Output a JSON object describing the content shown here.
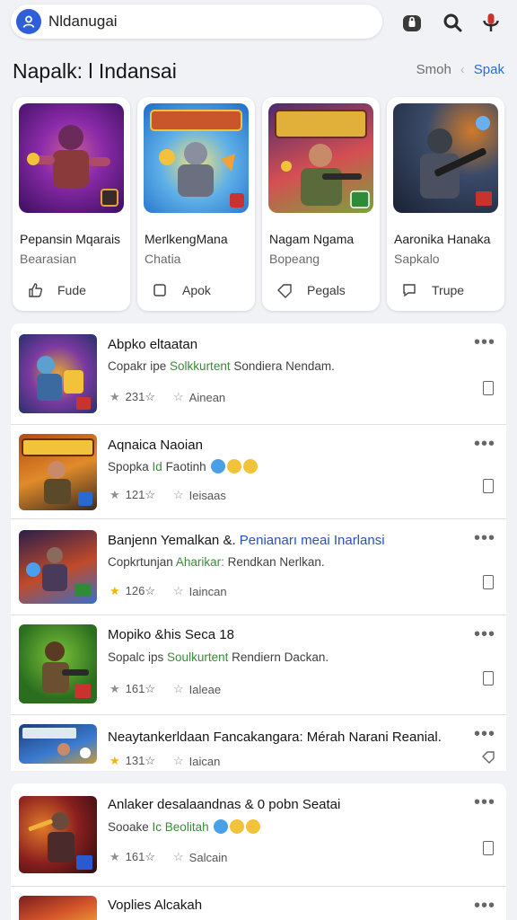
{
  "search": {
    "value": "Nldanugai"
  },
  "section": {
    "title": "Napalk: l Indansai",
    "link1": "Smoh",
    "link2": "Spak"
  },
  "cards": [
    {
      "title": "Pepansin Mqarais",
      "sub": "Bearasian",
      "action": "Fude",
      "icon": "thumb-up-icon",
      "palette": [
        "#3a0f5e",
        "#8a2aa8",
        "#c95b9a"
      ]
    },
    {
      "title": "MerlkengMana",
      "sub": "Chatia",
      "action": "Apok",
      "icon": "square-icon",
      "palette": [
        "#1f6cc9",
        "#5fb0e8",
        "#f2c23a"
      ]
    },
    {
      "title": "Nagam Ngama",
      "sub": "Bopeang",
      "action": "Pegals",
      "icon": "tag-icon",
      "palette": [
        "#4b2a6e",
        "#d54f52",
        "#7aa33c"
      ]
    },
    {
      "title": "Aaronika Hanaka",
      "sub": "Sapkalo",
      "action": "Trupe",
      "icon": "comment-icon",
      "palette": [
        "#1a2233",
        "#3a4a68",
        "#d07a2a"
      ]
    }
  ],
  "list": [
    {
      "title": "Abpko eltaatan",
      "sub_a": "Copakr ipe ",
      "sub_green": "Solkkurtent",
      "sub_b": " Sondiera Nendam.",
      "rating": "231☆",
      "meta": "Ainean",
      "star": "grey",
      "palette": [
        "#28306e",
        "#7b3aa0",
        "#e2a436"
      ]
    },
    {
      "title": "Aqnaica Naoian",
      "sub_a": "Spopka ",
      "sub_green": "Id",
      "sub_b": " Faotinh",
      "emoji": true,
      "rating": "121☆",
      "meta": "Ieisaas",
      "star": "grey",
      "palette": [
        "#b34b12",
        "#e08b2a",
        "#3c2a1e"
      ]
    },
    {
      "title": "Banjenn Yemalkan &. ",
      "title_blue": "Penianarı meai Inarlansi",
      "sub_a": "Copkrtunjan ",
      "sub_green": "Aharikar:",
      "sub_b": " Rendkan Nerlkan.",
      "rating": "126☆",
      "meta": "Iaincan",
      "star": "yellow",
      "palette": [
        "#2b1f4a",
        "#c04a2a",
        "#3a6ec8"
      ]
    },
    {
      "title": "Mopiko &his Seca 18",
      "sub_a": "Sopalc ips ",
      "sub_green": "Soulkurtent",
      "sub_b": " Rendiern Dackan.",
      "rating": "161☆",
      "meta": "Ialeae",
      "star": "grey",
      "palette": [
        "#2b6e1e",
        "#7ac23a",
        "#5a3a22"
      ]
    },
    {
      "title": "Neaytankerldaan Fancakangara: Mérah Narani Reanial.",
      "sub_a": "",
      "sub_green": "",
      "sub_b": "",
      "rating": "131☆",
      "meta": "Iaican",
      "star": "yellow",
      "palette": [
        "#1c3d7a",
        "#3b7bd0",
        "#c79a3a"
      ]
    },
    {
      "title": "Anlaker desalaandnas & 0 pobn Seatai",
      "sub_a": "Sooake ",
      "sub_green": "Ic Beolitah",
      "sub_b": "",
      "emoji": true,
      "rating": "161☆",
      "meta": "Salcain",
      "star": "grey",
      "palette": [
        "#2a0d0d",
        "#8a1f1f",
        "#e27a2a"
      ]
    },
    {
      "title": "Voplies Alcakah",
      "sub_a": "",
      "sub_green": "",
      "sub_b": "",
      "rating": "",
      "meta": "",
      "star": "grey",
      "palette": [
        "#7a1e1e",
        "#d4542a",
        "#f0b23a"
      ]
    }
  ]
}
